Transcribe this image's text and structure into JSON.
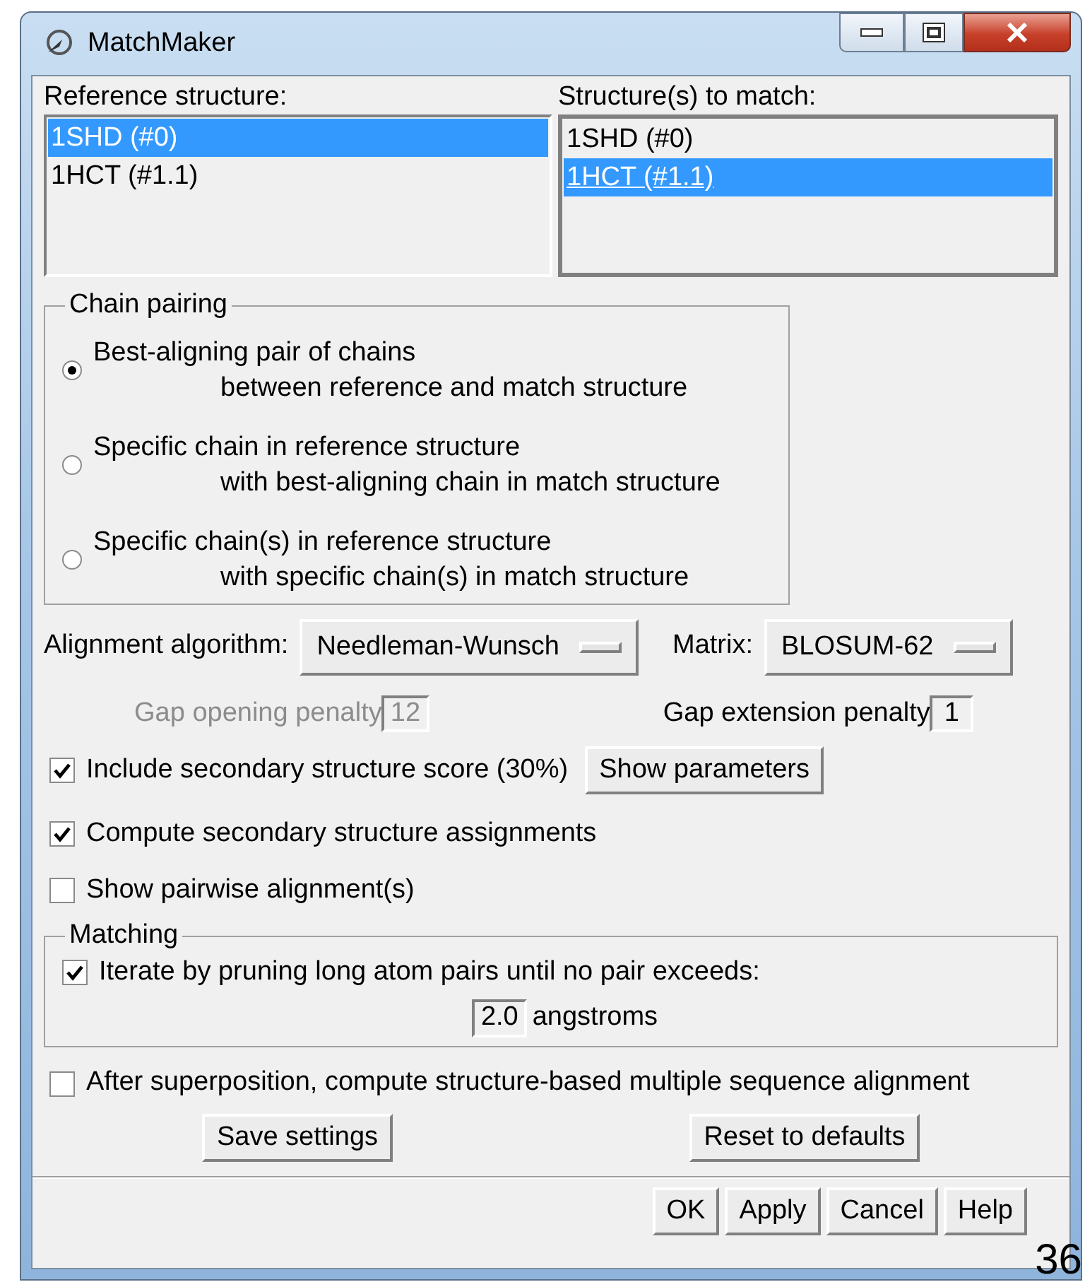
{
  "window": {
    "title": "MatchMaker"
  },
  "reference": {
    "label": "Reference structure:",
    "items": [
      {
        "text": "1SHD (#0)",
        "selected": true,
        "focused": false
      },
      {
        "text": "1HCT (#1.1)",
        "selected": false,
        "focused": false
      }
    ]
  },
  "match": {
    "label": "Structure(s) to match:",
    "items": [
      {
        "text": "1SHD (#0)",
        "selected": false,
        "focused": false
      },
      {
        "text": "1HCT (#1.1)",
        "selected": true,
        "focused": true
      }
    ]
  },
  "chain_pairing": {
    "title": "Chain pairing",
    "options": [
      {
        "line1": "Best-aligning pair of chains",
        "line2": "between reference and match structure",
        "selected": true
      },
      {
        "line1": "Specific chain in reference structure",
        "line2": "with best-aligning chain in match structure",
        "selected": false
      },
      {
        "line1": "Specific chain(s) in reference structure",
        "line2": "with specific chain(s) in match structure",
        "selected": false
      }
    ]
  },
  "algorithm": {
    "label": "Alignment algorithm:",
    "value": "Needleman-Wunsch"
  },
  "matrix": {
    "label": "Matrix:",
    "value": "BLOSUM-62"
  },
  "gap_opening": {
    "label": "Gap opening penalty",
    "value": "12",
    "disabled": true
  },
  "gap_extension": {
    "label": "Gap extension penalty",
    "value": "1",
    "disabled": false
  },
  "options": [
    {
      "label": "Include secondary structure score (30%)",
      "checked": true,
      "button": "Show parameters"
    },
    {
      "label": "Compute secondary structure assignments",
      "checked": true
    },
    {
      "label": "Show pairwise alignment(s)",
      "checked": false
    }
  ],
  "matching": {
    "title": "Matching",
    "iterate": {
      "label": "Iterate by pruning long atom pairs until no pair exceeds:",
      "checked": true
    },
    "cutoff": "2.0",
    "unit": "angstroms"
  },
  "after": {
    "label": "After superposition, compute structure-based multiple sequence alignment",
    "checked": false
  },
  "settings_buttons": [
    "Save settings",
    "Reset to defaults"
  ],
  "dialog_buttons": [
    "OK",
    "Apply",
    "Cancel",
    "Help"
  ],
  "page_number": "36"
}
